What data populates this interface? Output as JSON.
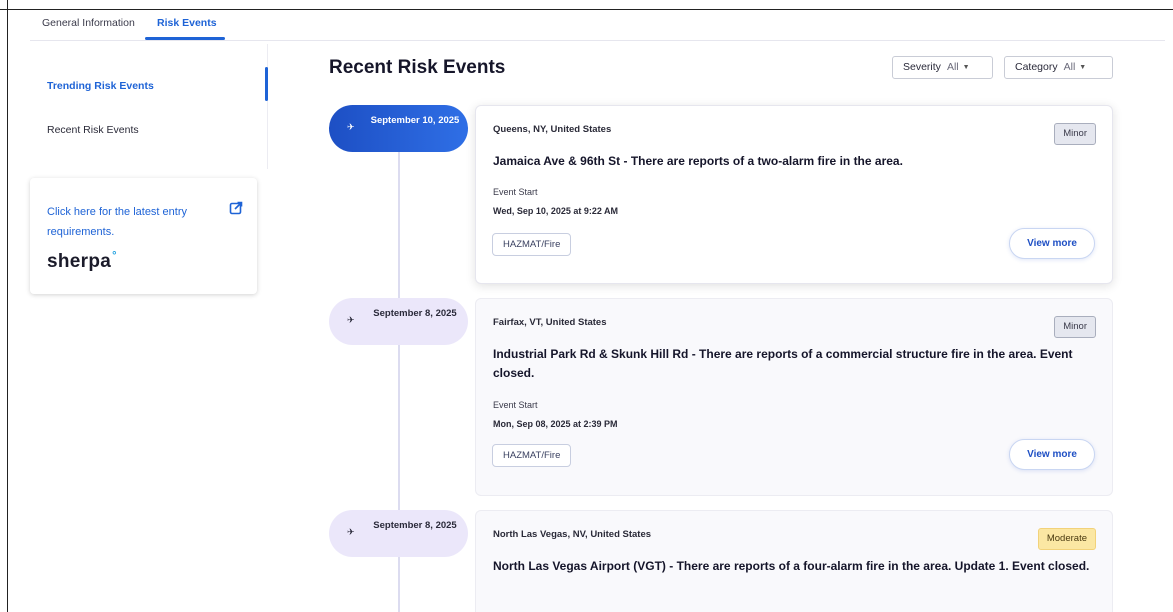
{
  "tabs": {
    "general": "General Information",
    "risk_events": "Risk Events"
  },
  "side_nav": {
    "trending": "Trending Risk Events",
    "recent": "Recent Risk Events"
  },
  "sherpa": {
    "link_text": "Click here for the latest entry requirements.",
    "logo_text": "sherpa",
    "logo_mark": "°"
  },
  "main": {
    "title": "Recent Risk Events"
  },
  "filters": {
    "severity": {
      "label": "Severity",
      "value": "All"
    },
    "category": {
      "label": "Category",
      "value": "All"
    }
  },
  "events": [
    {
      "date": "September 10, 2025",
      "location": "Queens, NY, United States",
      "severity": "Minor",
      "headline": "Jamaica Ave & 96th St - There are reports of a two-alarm fire in the area.",
      "event_start_label": "Event Start",
      "event_start": "Wed, Sep 10, 2025 at 9:22 AM",
      "category": "HAZMAT/Fire",
      "action": "View more"
    },
    {
      "date": "September 8, 2025",
      "location": "Fairfax, VT, United States",
      "severity": "Minor",
      "headline": "Industrial Park Rd & Skunk Hill Rd - There are reports of a commercial structure fire in the area. Event closed.",
      "event_start_label": "Event Start",
      "event_start": "Mon, Sep 08, 2025 at 2:39 PM",
      "category": "HAZMAT/Fire",
      "action": "View more"
    },
    {
      "date": "September 8, 2025",
      "location": "North Las Vegas, NV, United States",
      "severity": "Moderate",
      "headline": "North Las Vegas Airport (VGT) - There are reports of a four-alarm fire in the area. Update 1. Event closed."
    }
  ],
  "colors": {
    "accent": "#1e63d6",
    "moderate": "#fbe7a3",
    "minor": "#e5e7ef",
    "pill": "#ebe7fa"
  },
  "icons": {
    "timeline_pin": "plane-icon",
    "external_link": "external-link-icon"
  }
}
